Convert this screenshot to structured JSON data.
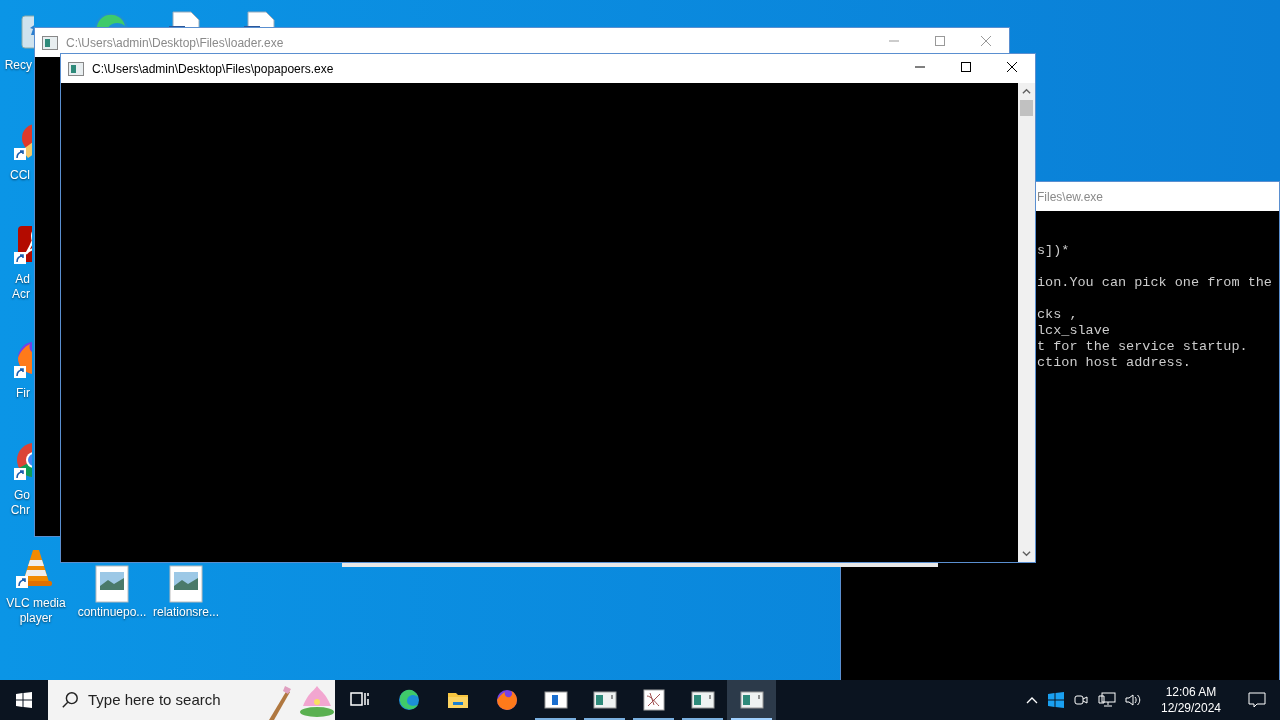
{
  "desktop": {
    "icons": [
      {
        "kind": "recycle",
        "label_lines": [
          "Recy"
        ],
        "cut_off": true,
        "shortcut": false
      },
      {
        "kind": "edge",
        "cut_off": true,
        "shortcut": false
      },
      {
        "kind": "document",
        "cut_off": true,
        "shortcut": false
      },
      {
        "kind": "document",
        "cut_off": true,
        "shortcut": false
      },
      {
        "kind": "ccleaner",
        "label_lines": [
          "CCl"
        ],
        "cut_off": true,
        "shortcut": true
      },
      {
        "kind": "acrobat",
        "label_lines": [
          "Ad",
          "Acr"
        ],
        "cut_off": true,
        "shortcut": true
      },
      {
        "kind": "firefox",
        "label_lines": [
          "Fir"
        ],
        "cut_off": true,
        "shortcut": true
      },
      {
        "kind": "chrome",
        "label_lines": [
          "Go",
          "Chr"
        ],
        "cut_off": true,
        "shortcut": true
      },
      {
        "kind": "vlc",
        "label_lines": [
          "VLC media",
          "player"
        ],
        "cut_off": false,
        "shortcut": true
      },
      {
        "kind": "image",
        "label_lines": [
          "continuepo..."
        ],
        "cut_off": false,
        "shortcut": false
      },
      {
        "kind": "image",
        "label_lines": [
          "relationsre..."
        ],
        "cut_off": false,
        "shortcut": false
      }
    ]
  },
  "windows": [
    {
      "title": "Files\\ew.exe",
      "active": false,
      "console_blocks": [
        [
          "s])*"
        ],
        [
          "ion.You can pick one from the"
        ],
        [
          "cks ,",
          "lcx_slave",
          "t for the service startup.",
          "ction host address."
        ]
      ]
    },
    {
      "title": "C:\\Users\\admin\\Desktop\\Files\\loader.exe",
      "active": false
    },
    {
      "title": "C:\\Users\\admin\\Desktop\\Files\\popapoers.exe",
      "active": true
    }
  ],
  "taskbar": {
    "search": {
      "placeholder": "Type here to search"
    },
    "apps": [
      {
        "kind": "taskview",
        "running": false,
        "selected": false
      },
      {
        "kind": "edge",
        "running": false,
        "selected": false
      },
      {
        "kind": "folder",
        "running": false,
        "selected": false
      },
      {
        "kind": "firefox",
        "running": false,
        "selected": false
      },
      {
        "kind": "console-blue",
        "running": true,
        "selected": false
      },
      {
        "kind": "console",
        "running": true,
        "selected": false
      },
      {
        "kind": "sketch",
        "running": true,
        "selected": false
      },
      {
        "kind": "console",
        "running": true,
        "selected": false
      },
      {
        "kind": "console",
        "running": true,
        "selected": true
      }
    ],
    "clock": {
      "time": "12:06 AM",
      "date": "12/29/2024"
    }
  }
}
